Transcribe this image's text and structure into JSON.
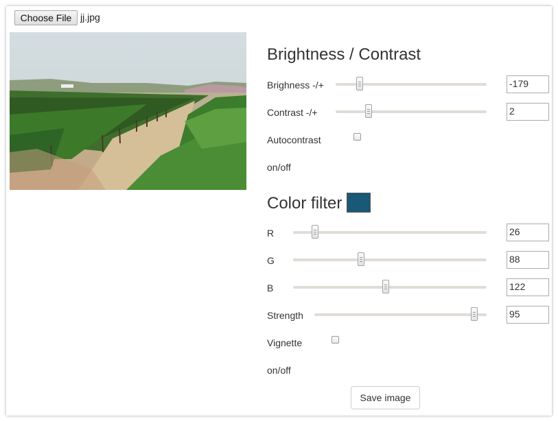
{
  "file": {
    "button_label": "Choose File",
    "file_name": "jj.jpg"
  },
  "brightness_contrast": {
    "title": "Brightness / Contrast",
    "brightness": {
      "label": "Brighness -/+",
      "value": "-179",
      "slider_fraction": 0.16
    },
    "contrast": {
      "label": "Contrast -/+",
      "value": "2",
      "slider_fraction": 0.22
    },
    "autocontrast": {
      "label": "Autocontrast",
      "sublabel": "on/off",
      "checked": false
    }
  },
  "color_filter": {
    "title": "Color filter",
    "swatch_color": "#1a5878",
    "r": {
      "label": "R",
      "value": "26",
      "slider_fraction": 0.115
    },
    "g": {
      "label": "G",
      "value": "88",
      "slider_fraction": 0.35
    },
    "b": {
      "label": "B",
      "value": "122",
      "slider_fraction": 0.48
    },
    "strength": {
      "label": "Strength",
      "value": "95",
      "slider_fraction": 0.93
    },
    "vignette": {
      "label": "Vignette",
      "sublabel": "on/off",
      "checked": false
    }
  },
  "actions": {
    "save_label": "Save image"
  }
}
